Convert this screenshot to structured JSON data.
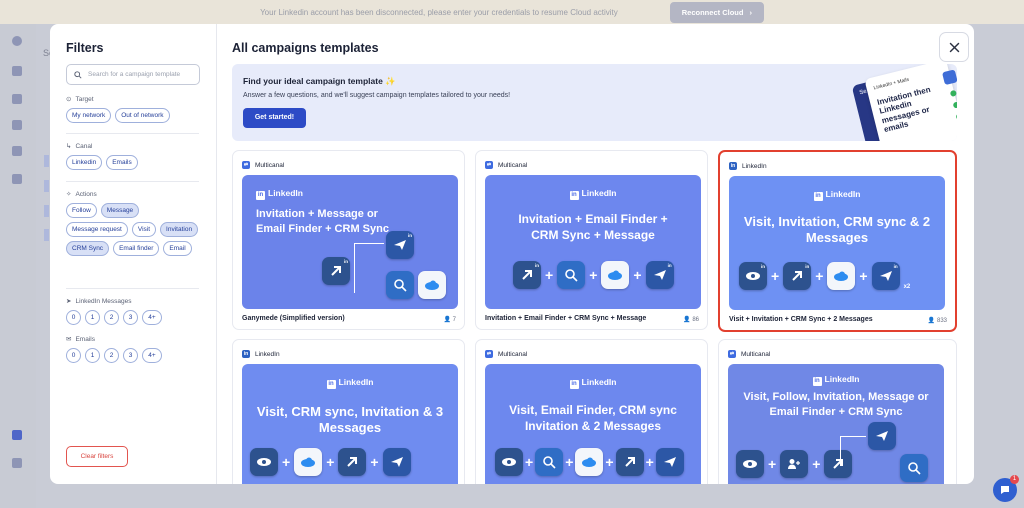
{
  "topbar": {
    "message": "Your Linkedin account has been disconnected, please enter your credentials to resume Cloud activity",
    "button": "Reconnect Cloud"
  },
  "background": {
    "partial_text": "Se"
  },
  "chat": {
    "badge": "1"
  },
  "filters": {
    "title": "Filters",
    "search_placeholder": "Search for a campaign template",
    "target": {
      "label": "Target",
      "options": [
        "My network",
        "Out of network"
      ]
    },
    "canal": {
      "label": "Canal",
      "options": [
        "Linkedin",
        "Emails"
      ]
    },
    "actions": {
      "label": "Actions",
      "options": [
        "Follow",
        "Message",
        "Message request",
        "Visit",
        "Invitation",
        "CRM Sync",
        "Email finder",
        "Email"
      ]
    },
    "linkedin_messages": {
      "label": "LinkedIn Messages",
      "options": [
        "0",
        "1",
        "2",
        "3",
        "4+"
      ]
    },
    "emails": {
      "label": "Emails",
      "options": [
        "0",
        "1",
        "2",
        "3",
        "4+"
      ]
    },
    "clear": "Clear filters"
  },
  "main": {
    "title": "All campaigns templates",
    "banner": {
      "title": "Find your ideal campaign template ✨",
      "desc": "Answer a few questions, and we'll suggest campaign templates tailored to your needs!",
      "button": "Get started!",
      "promo_back": "Se",
      "promo_mini": "LinkedIn + Mails",
      "promo_lines": "Invitation then Linkedin messages or emails"
    },
    "cards": [
      {
        "tag": "Multicanal",
        "thumb_brand": "LinkedIn",
        "thumb_title": "Invitation + Message or Email Finder + CRM Sync",
        "title": "Ganymede (Simplified version)",
        "count": "7"
      },
      {
        "tag": "Multicanal",
        "thumb_brand": "LinkedIn",
        "thumb_title": "Invitation + Email Finder + CRM Sync + Message",
        "title": "Invitation + Email Finder + CRM Sync + Message",
        "count": "86"
      },
      {
        "tag": "LinkedIn",
        "thumb_brand": "LinkedIn",
        "thumb_title": "Visit, Invitation, CRM sync & 2 Messages",
        "title": "Visit + Invitation + CRM Sync + 2 Messages",
        "count": "833",
        "multiplier": "x2"
      },
      {
        "tag": "LinkedIn",
        "thumb_brand": "LinkedIn",
        "thumb_title": "Visit, CRM sync, Invitation & 3 Messages"
      },
      {
        "tag": "Multicanal",
        "thumb_brand": "LinkedIn",
        "thumb_title": "Visit, Email Finder, CRM sync Invitation & 2 Messages"
      },
      {
        "tag": "Multicanal",
        "thumb_brand": "LinkedIn",
        "thumb_title": "Visit, Follow, Invitation, Message or Email Finder + CRM Sync"
      }
    ]
  }
}
